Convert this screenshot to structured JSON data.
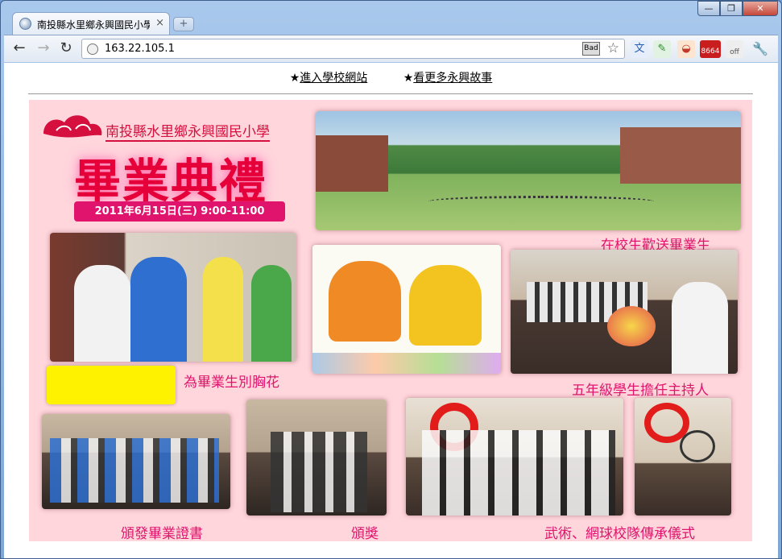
{
  "browser": {
    "tab_title": "南投縣水里鄉永興國民小學",
    "tab_close": "×",
    "new_tab": "+",
    "url": "163.22.105.1",
    "bad_label": "Bad",
    "ext_badge": "8664",
    "ext_off": "off",
    "window_buttons": {
      "minimize": "—",
      "maximize": "❐",
      "close": "✕"
    },
    "nav": {
      "back": "←",
      "forward": "→",
      "reload": "↻"
    }
  },
  "links": {
    "bullet": "★",
    "school_site": "進入學校網站",
    "stories": "看更多永興故事"
  },
  "poster": {
    "school_name": "南投縣水里鄉永興國民小學",
    "title": "畢業典禮",
    "date": "2011年6月15日(三)  9:00-11:00",
    "captions": {
      "farewell": "在校生歡送畢業生",
      "corsage": "為畢業生別胸花",
      "host": "五年級學生擔任主持人",
      "certificate": "頒發畢業證書",
      "award": "頒獎",
      "martial": "武術、網球校隊傳承儀式"
    }
  },
  "colors": {
    "poster_bg": "#ffd6dc",
    "caption": "#e0146c",
    "title": "#e60039"
  }
}
